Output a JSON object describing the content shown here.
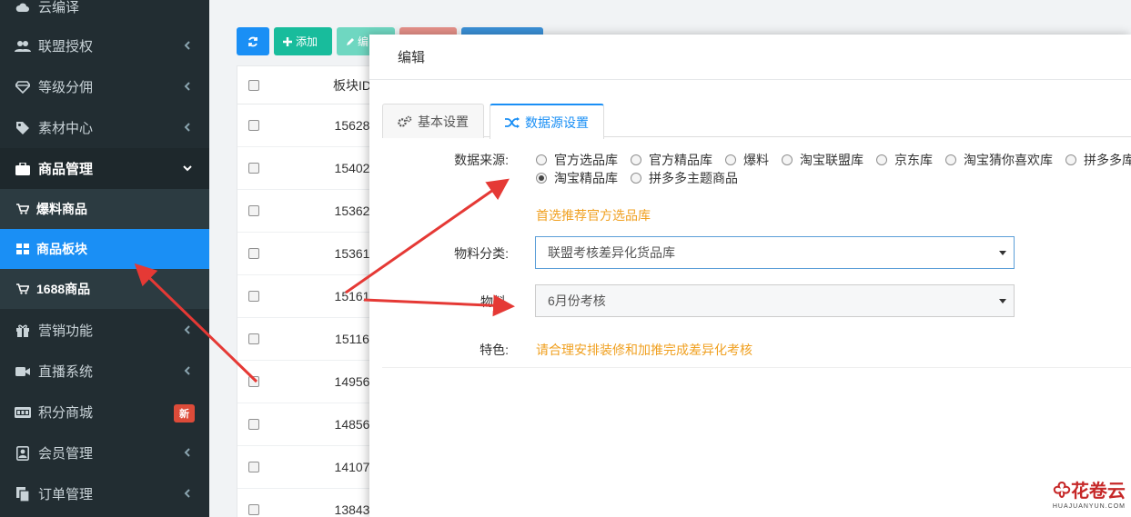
{
  "sidebar": {
    "items": [
      {
        "label": "云编译",
        "icon": "cloud-icon"
      },
      {
        "label": "联盟授权",
        "icon": "users-icon"
      },
      {
        "label": "等级分佣",
        "icon": "diamond-icon"
      },
      {
        "label": "素材中心",
        "icon": "tag-icon"
      },
      {
        "label": "商品管理",
        "icon": "briefcase-icon"
      },
      {
        "label": "营销功能",
        "icon": "gift-icon"
      },
      {
        "label": "直播系统",
        "icon": "video-icon"
      },
      {
        "label": "积分商城",
        "icon": "jcb-card-icon",
        "badge": "新"
      },
      {
        "label": "会员管理",
        "icon": "user-box-icon"
      },
      {
        "label": "订单管理",
        "icon": "copy-icon"
      }
    ],
    "sub_items": [
      {
        "label": "爆料商品",
        "icon": "cart-icon"
      },
      {
        "label": "商品板块",
        "icon": "grid-icon"
      },
      {
        "label": "1688商品",
        "icon": "cart-icon"
      }
    ]
  },
  "toolbar": {
    "add_label": "添加",
    "edit_label": "编"
  },
  "table": {
    "header": "板块ID",
    "rows": [
      "15628",
      "15402",
      "15362",
      "15361",
      "15161",
      "15116",
      "14956",
      "14856",
      "14107",
      "13843"
    ]
  },
  "modal": {
    "title": "编辑",
    "tabs": [
      "基本设置",
      "数据源设置"
    ],
    "source_label": "数据来源:",
    "source_options": [
      "官方选品库",
      "官方精品库",
      "爆料",
      "淘宝联盟库",
      "京东库",
      "淘宝猜你喜欢库",
      "拼多多库"
    ],
    "source_options_row2": [
      "淘宝精品库",
      "拼多多主题商品"
    ],
    "source_hint": "首选推荐官方选品库",
    "category_label": "物料分类:",
    "category_value": "联盟考核差异化货品库",
    "material_label": "物料",
    "material_value": "6月份考核",
    "feature_label": "特色:",
    "feature_value": "请合理安排装修和加推完成差异化考核"
  },
  "watermark": {
    "text": "花卷云",
    "sub": "HUAJUANYUN.COM"
  },
  "colors": {
    "sidebar_bg": "#222d32",
    "active_blue": "#1a8ff5",
    "hint_orange": "#f0a020",
    "arrow_red": "#e53935"
  }
}
